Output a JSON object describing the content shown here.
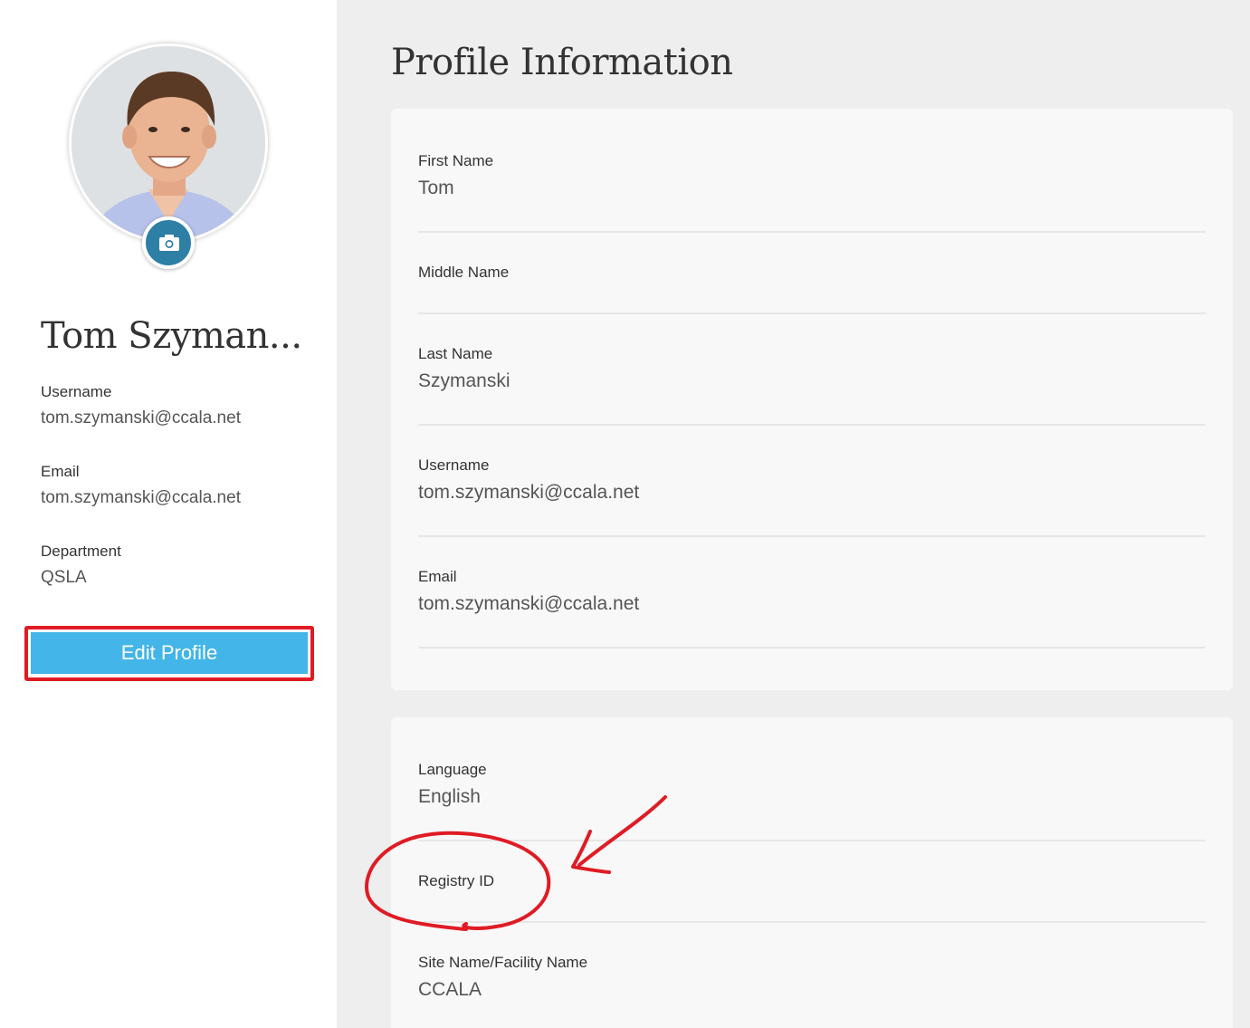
{
  "sidebar": {
    "full_name": "Tom Szyman...",
    "fields": [
      {
        "label": "Username",
        "value": "tom.szymanski@ccala.net"
      },
      {
        "label": "Email",
        "value": "tom.szymanski@ccala.net"
      },
      {
        "label": "Department",
        "value": "QSLA"
      }
    ],
    "edit_button_label": "Edit Profile",
    "camera_icon": "camera-icon"
  },
  "main": {
    "title": "Profile Information",
    "card1": [
      {
        "label": "First Name",
        "value": "Tom"
      },
      {
        "label": "Middle Name",
        "value": ""
      },
      {
        "label": "Last Name",
        "value": "Szymanski"
      },
      {
        "label": "Username",
        "value": "tom.szymanski@ccala.net"
      },
      {
        "label": "Email",
        "value": "tom.szymanski@ccala.net"
      }
    ],
    "card2": [
      {
        "label": "Language",
        "value": "English"
      },
      {
        "label": "Registry ID",
        "value": ""
      },
      {
        "label": "Site Name/Facility Name",
        "value": "CCALA"
      }
    ]
  },
  "colors": {
    "accent": "#43b5e8",
    "camera": "#2e7fa6",
    "annotation": "#e01b24",
    "main_bg": "#eeeeee",
    "card_bg": "#f8f8f8"
  }
}
